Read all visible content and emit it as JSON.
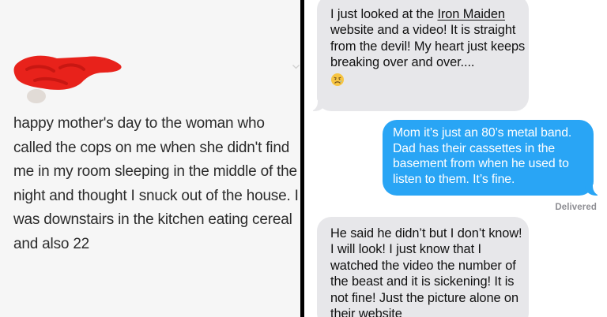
{
  "tweet": {
    "text": "happy mother's day to the woman who called the cops on me when she didn't find me in my room sleeping in the middle of the night and thought I snuck out of the house. I was downstairs in the kitchen eating cereal and also 22",
    "redaction_color": "#e8221b"
  },
  "messages": [
    {
      "direction": "received",
      "text_before": "I just looked at the ",
      "link_text": "Iron Maiden",
      "text_after": " website and a video! It is straight from the devil! My heart just keeps breaking over and over....",
      "emoji": "sad-face-emoji"
    },
    {
      "direction": "sent",
      "text": "Mom it’s just an 80’s metal band. Dad has their cassettes in the basement from when he used to listen to them. It’s fine.",
      "status": "Delivered"
    },
    {
      "direction": "received",
      "text": "He said he didn’t but I don’t know! I will look! I just know that I watched the video the number of the beast and it is sickening! It is not fine! Just the picture alone on their website"
    }
  ],
  "colors": {
    "sent_bubble": "#29a5f5",
    "received_bubble": "#e7e7ea",
    "divider": "#000000",
    "tweet_background": "#f6f6f6"
  }
}
